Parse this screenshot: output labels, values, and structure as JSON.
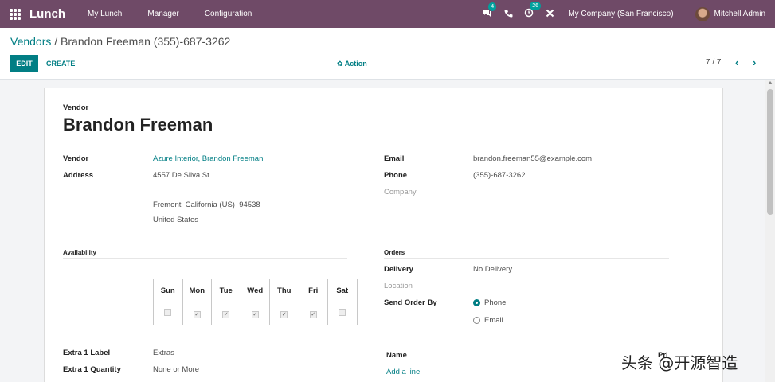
{
  "navbar": {
    "brand": "Lunch",
    "menu": [
      "My Lunch",
      "Manager",
      "Configuration"
    ],
    "chat_badge": "4",
    "activity_badge": "26",
    "company": "My Company (San Francisco)",
    "user": "Mitchell Admin"
  },
  "breadcrumb": {
    "parent": "Vendors",
    "separator": " / ",
    "current": "Brandon Freeman (355)-687-3262"
  },
  "toolbar": {
    "edit": "EDIT",
    "create": "CREATE",
    "action": "Action",
    "pager": "7 / 7"
  },
  "form": {
    "vendor_caption": "Vendor",
    "vendor_name": "Brandon Freeman",
    "left": {
      "vendor_label": "Vendor",
      "vendor_value": "Azure Interior, Brandon Freeman",
      "address_label": "Address",
      "street": "4557 De Silva St",
      "city_line": "Fremont  California (US)  94538",
      "country": "United States"
    },
    "right": {
      "email_label": "Email",
      "email_value": "brandon.freeman55@example.com",
      "phone_label": "Phone",
      "phone_value": "(355)-687-3262",
      "company_placeholder": "Company"
    },
    "availability": {
      "title": "Availability",
      "days": [
        "Sun",
        "Mon",
        "Tue",
        "Wed",
        "Thu",
        "Fri",
        "Sat"
      ],
      "checked": [
        false,
        true,
        true,
        true,
        true,
        true,
        false
      ]
    },
    "orders": {
      "title": "Orders",
      "delivery_label": "Delivery",
      "delivery_value": "No Delivery",
      "location_placeholder": "Location",
      "send_label": "Send Order By",
      "options": [
        "Phone",
        "Email"
      ],
      "selected": "Phone"
    },
    "extras": {
      "extra1_label": "Extra 1 Label",
      "extra1_value": "Extras",
      "extra1_qty_label": "Extra 1 Quantity",
      "extra1_qty_value": "None or More"
    },
    "lines": {
      "name_header": "Name",
      "price_header": "Pri",
      "add_line": "Add a line"
    }
  },
  "watermark": "头条 @开源智造"
}
